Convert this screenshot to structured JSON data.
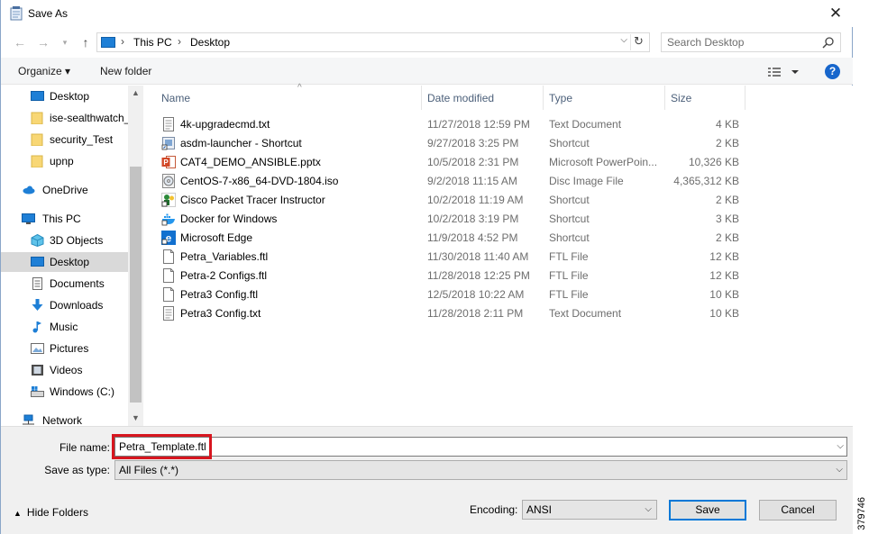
{
  "window": {
    "title": "Save As"
  },
  "address": {
    "segments": [
      "This PC",
      "Desktop"
    ]
  },
  "search": {
    "placeholder": "Search Desktop"
  },
  "toolbar": {
    "organize": "Organize ▾",
    "new_folder": "New folder"
  },
  "sidebar": {
    "items": [
      {
        "label": "Desktop",
        "icon": "desktop-icon"
      },
      {
        "label": "ise-sealthwatch_",
        "icon": "folder-icon"
      },
      {
        "label": "security_Test",
        "icon": "folder-icon"
      },
      {
        "label": "upnp",
        "icon": "folder-icon"
      },
      {
        "label": "OneDrive",
        "icon": "cloud-icon"
      },
      {
        "label": "This PC",
        "icon": "computer-icon"
      },
      {
        "label": "3D Objects",
        "icon": "cube-icon"
      },
      {
        "label": "Desktop",
        "icon": "desktop-icon",
        "selected": true
      },
      {
        "label": "Documents",
        "icon": "document-icon"
      },
      {
        "label": "Downloads",
        "icon": "download-icon"
      },
      {
        "label": "Music",
        "icon": "music-icon"
      },
      {
        "label": "Pictures",
        "icon": "picture-icon"
      },
      {
        "label": "Videos",
        "icon": "video-icon"
      },
      {
        "label": "Windows (C:)",
        "icon": "drive-icon"
      },
      {
        "label": "Network",
        "icon": "network-icon"
      }
    ]
  },
  "columns": {
    "name": "Name",
    "date": "Date modified",
    "type": "Type",
    "size": "Size"
  },
  "files": [
    {
      "name": "4k-upgradecmd.txt",
      "date": "11/27/2018 12:59 PM",
      "type": "Text Document",
      "size": "4 KB",
      "icon": "text-file-icon"
    },
    {
      "name": "asdm-launcher - Shortcut",
      "date": "9/27/2018 3:25 PM",
      "type": "Shortcut",
      "size": "2 KB",
      "icon": "shortcut-icon"
    },
    {
      "name": "CAT4_DEMO_ANSIBLE.pptx",
      "date": "10/5/2018 2:31 PM",
      "type": "Microsoft PowerPoin...",
      "size": "10,326 KB",
      "icon": "powerpoint-icon"
    },
    {
      "name": "CentOS-7-x86_64-DVD-1804.iso",
      "date": "9/2/2018 11:15 AM",
      "type": "Disc Image File",
      "size": "4,365,312 KB",
      "icon": "disc-icon"
    },
    {
      "name": "Cisco Packet Tracer Instructor",
      "date": "10/2/2018 11:19 AM",
      "type": "Shortcut",
      "size": "2 KB",
      "icon": "packet-tracer-icon"
    },
    {
      "name": "Docker for Windows",
      "date": "10/2/2018 3:19 PM",
      "type": "Shortcut",
      "size": "3 KB",
      "icon": "docker-icon"
    },
    {
      "name": "Microsoft Edge",
      "date": "11/9/2018 4:52 PM",
      "type": "Shortcut",
      "size": "2 KB",
      "icon": "edge-icon"
    },
    {
      "name": "Petra_Variables.ftl",
      "date": "11/30/2018 11:40 AM",
      "type": "FTL File",
      "size": "12 KB",
      "icon": "blank-file-icon"
    },
    {
      "name": "Petra-2 Configs.ftl",
      "date": "11/28/2018 12:25 PM",
      "type": "FTL File",
      "size": "12 KB",
      "icon": "blank-file-icon"
    },
    {
      "name": "Petra3 Config.ftl",
      "date": "12/5/2018 10:22 AM",
      "type": "FTL File",
      "size": "10 KB",
      "icon": "blank-file-icon"
    },
    {
      "name": "Petra3 Config.txt",
      "date": "11/28/2018 2:11 PM",
      "type": "Text Document",
      "size": "10 KB",
      "icon": "text-file-icon"
    }
  ],
  "form": {
    "file_name_label": "File name:",
    "file_name_value": "Petra_Template.ftl",
    "save_type_label": "Save as type:",
    "save_type_value": "All Files  (*.*)",
    "encoding_label": "Encoding:",
    "encoding_value": "ANSI"
  },
  "buttons": {
    "hide_folders": "Hide Folders",
    "save": "Save",
    "cancel": "Cancel"
  },
  "figure_id": "379746",
  "colors": {
    "accent": "#0078d7",
    "highlight": "#d7161f",
    "selection": "#d9d9d9"
  }
}
